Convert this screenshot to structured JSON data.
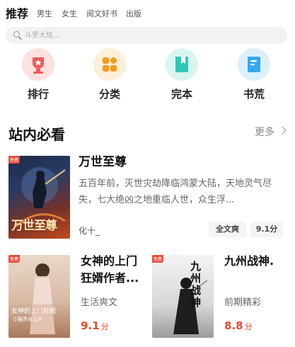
{
  "tabs": [
    "推荐",
    "男生",
    "女生",
    "阅文好书",
    "出版"
  ],
  "search": {
    "placeholder": "斗罗大陆..."
  },
  "categories": [
    {
      "label": "排行",
      "icon": "trophy-icon",
      "color": "#ef5a5a",
      "bg": "#fde0e0"
    },
    {
      "label": "分类",
      "icon": "grid-icon",
      "color": "#f59a1c",
      "bg": "#fdefd9"
    },
    {
      "label": "完本",
      "icon": "book-icon",
      "color": "#2ec9b4",
      "bg": "#d9f5ef"
    },
    {
      "label": "书荒",
      "icon": "list-icon",
      "color": "#35a8f0",
      "bg": "#dcf0fb"
    }
  ],
  "section": {
    "title": "站内必看",
    "more": "更多"
  },
  "featured": {
    "title": "万世至尊",
    "description": "五百年前，灭世灾劫降临鸿蒙大陆，天地灵气尽失，七大绝凶之地重临人世，众生浮...",
    "author": "化十_",
    "tag": "全文爽",
    "score": "9.1分",
    "badge": "免费",
    "cover_text": "万世至尊"
  },
  "books": [
    {
      "title": "女神的上门狂婿作者...",
      "genre": "生活爽文",
      "score": "9.1",
      "unit": "分",
      "badge": "免费",
      "cover_text": "女神的上门狂婿",
      "cover_sub": "小猫弄名公天"
    },
    {
      "title": "九州战神.",
      "genre": "前期精彩",
      "score": "8.8",
      "unit": "分",
      "badge": "免费",
      "cover_text": "九州战神"
    }
  ]
}
